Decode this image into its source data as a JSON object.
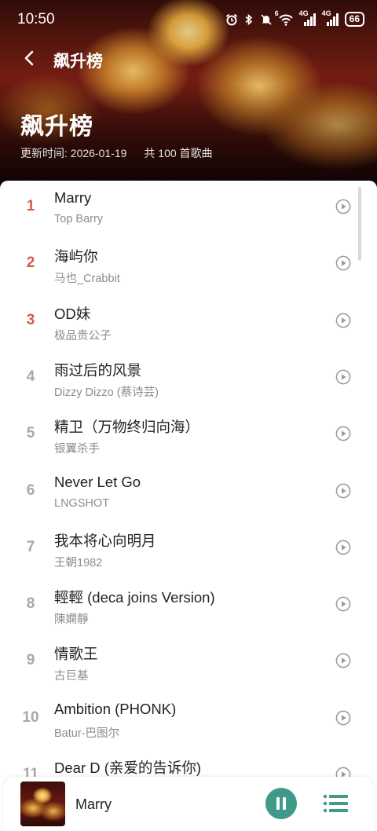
{
  "status_bar": {
    "time": "10:50",
    "battery": "66",
    "signal_1": "4G",
    "signal_2": "4G",
    "wifi_tag": "6"
  },
  "nav": {
    "title": "飙升榜"
  },
  "hero": {
    "title": "飙升榜",
    "updated": "更新时间: 2026-01-19",
    "count": "共 100 首歌曲"
  },
  "songs": [
    {
      "rank": "1",
      "title": "Marry",
      "artist": "Top Barry"
    },
    {
      "rank": "2",
      "title": "海屿你",
      "artist": "马也_Crabbit"
    },
    {
      "rank": "3",
      "title": "OD妹",
      "artist": "极品贵公子"
    },
    {
      "rank": "4",
      "title": "雨过后的风景",
      "artist": "Dizzy Dizzo (蔡诗芸)"
    },
    {
      "rank": "5",
      "title": "精卫（万物终归向海）",
      "artist": "银翼杀手"
    },
    {
      "rank": "6",
      "title": "Never Let Go",
      "artist": "LNGSHOT"
    },
    {
      "rank": "7",
      "title": "我本将心向明月",
      "artist": "王朝1982"
    },
    {
      "rank": "8",
      "title": "輕輕 (deca joins Version)",
      "artist": "陳嫻靜"
    },
    {
      "rank": "9",
      "title": "情歌王",
      "artist": "古巨基"
    },
    {
      "rank": "10",
      "title": "Ambition (PHONK)",
      "artist": "Batur-巴图尔"
    },
    {
      "rank": "11",
      "title": "Dear D (亲爱的告诉你)",
      "artist": ""
    }
  ],
  "player": {
    "title": "Marry"
  },
  "colors": {
    "accent": "#3f9a89",
    "top_rank": "#d65a4c"
  }
}
